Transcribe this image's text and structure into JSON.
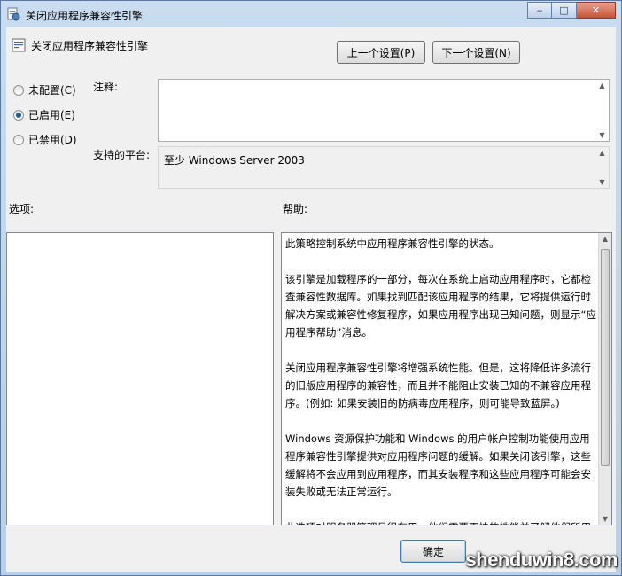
{
  "window": {
    "title": "关闭应用程序兼容性引擎",
    "controls": {
      "minimize": "‒",
      "maximize": "□",
      "close": "✕"
    }
  },
  "header": {
    "title": "关闭应用程序兼容性引擎",
    "prev_label": "上一个设置(P)",
    "next_label": "下一个设置(N)"
  },
  "state": {
    "options": [
      {
        "label": "未配置(C)",
        "selected": false
      },
      {
        "label": "已启用(E)",
        "selected": true
      },
      {
        "label": "已禁用(D)",
        "selected": false
      }
    ]
  },
  "comment": {
    "label": "注释:",
    "value": ""
  },
  "platform": {
    "label": "支持的平台:",
    "value": "至少 Windows Server 2003"
  },
  "options_section": {
    "label": "选项:"
  },
  "help_section": {
    "label": "帮助:",
    "paragraphs": [
      " 此策略控制系统中应用程序兼容性引擎的状态。",
      "该引擎是加载程序的一部分，每次在系统上启动应用程序时，它都检查兼容性数据库。如果找到匹配该应用程序的结果，它将提供运行时解决方案或兼容性修复程序，如果应用程序出现已知问题，则显示“应用程序帮助”消息。",
      "关闭应用程序兼容性引擎将增强系统性能。但是，这将降低许多流行的旧版应用程序的兼容性，而且并不能阻止安装已知的不兼容应用程序。(例如: 如果安装旧的防病毒应用程序，则可能导致蓝屏。)",
      "Windows 资源保护功能和 Windows 的用户帐户控制功能使用应用程序兼容性引擎提供对应用程序问题的缓解。如果关闭该引擎，这些缓解将不会应用到应用程序，而其安装程序和这些应用程序可能会安装失败或无法正常运行。",
      "此选项对服务器管理员很有用，他们需要更快的性能并了解他们所用应用程序的兼容性。对于每秒钟可能启动数百次应用程序且加载"
    ]
  },
  "footer": {
    "ok_label": "确定"
  },
  "watermark": {
    "text": "shenduwin8.com"
  }
}
